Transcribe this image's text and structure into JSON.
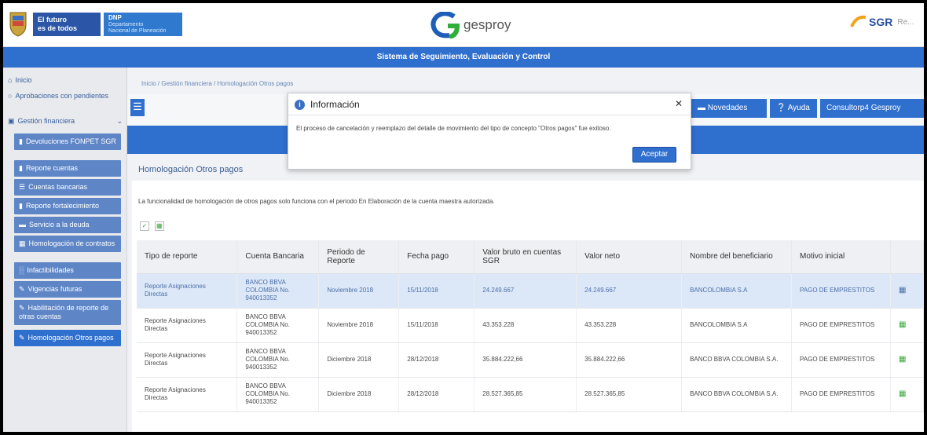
{
  "header": {
    "gov_logo_line1": "El futuro",
    "gov_logo_line2": "es de todos",
    "dnp_logo_title": "DNP",
    "dnp_logo_line1": "Departamento",
    "dnp_logo_line2": "Nacional de Planeación",
    "app_logo": "gesproy",
    "sgr_logo": "SGR",
    "sgr_sub": "Re..."
  },
  "system_bar": {
    "title": "Sistema de Seguimiento, Evaluación y Control"
  },
  "sidebar": {
    "items": [
      {
        "label": "Inicio"
      },
      {
        "label": "Aprobaciones con pendientes"
      },
      {
        "label": "Gestión financiera"
      }
    ],
    "subitems": [
      {
        "label": "Devoluciones FONPET SGR"
      },
      {
        "label": "Reporte cuentas"
      },
      {
        "label": "Cuentas bancarias"
      },
      {
        "label": "Reporte fortalecimiento"
      },
      {
        "label": "Servicio a la deuda"
      },
      {
        "label": "Homologación de contratos"
      },
      {
        "label": "Infactibilidades"
      },
      {
        "label": "Vigencias futuras"
      },
      {
        "label": "Habilitación de reporte de otras cuentas"
      },
      {
        "label": "Homologación Otros pagos"
      }
    ]
  },
  "breadcrumb": "Inicio / Gestión financiera / Homologación Otros pagos",
  "toolbar": {
    "novedades": "Novedades",
    "ayuda": "Ayuda",
    "consultor": "Consultorp4 Gesproy"
  },
  "page": {
    "title": "Homologación Otros pagos",
    "note": "La funcionalidad de homologación de otros pagos solo funciona con el periodo En Elaboración de la cuenta maestra autorizada."
  },
  "table": {
    "headers": [
      "Tipo de reporte",
      "Cuenta Bancaria",
      "Periodo de Reporte",
      "Fecha pago",
      "Valor bruto en cuentas SGR",
      "Valor neto",
      "Nombre del beneficiario",
      "Motivo inicial"
    ],
    "rows": [
      [
        "Reporte Asignaciones Directas",
        "BANCO BBVA COLOMBIA No. 940013352",
        "Noviembre 2018",
        "15/11/2018",
        "24.249.667",
        "24.249.667",
        "BANCOLOMBIA S.A",
        "PAGO DE EMPRESTITOS"
      ],
      [
        "Reporte Asignaciones Directas",
        "BANCO BBVA COLOMBIA No. 940013352",
        "Noviembre 2018",
        "15/11/2018",
        "43.353.228",
        "43.353.228",
        "BANCOLOMBIA S.A",
        "PAGO DE EMPRESTITOS"
      ],
      [
        "Reporte Asignaciones Directas",
        "BANCO BBVA COLOMBIA No. 940013352",
        "Diciembre 2018",
        "28/12/2018",
        "35.884.222,66",
        "35.884.222,66",
        "BANCO BBVA COLOMBIA S.A.",
        "PAGO DE EMPRESTITOS"
      ],
      [
        "Reporte Asignaciones Directas",
        "BANCO BBVA COLOMBIA No. 940013352",
        "Diciembre 2018",
        "28/12/2018",
        "28.527.365,85",
        "28.527.365,85",
        "BANCO BBVA COLOMBIA S.A.",
        "PAGO DE EMPRESTITOS"
      ]
    ]
  },
  "modal": {
    "title": "Información",
    "body": "El proceso de cancelación y reemplazo del detalle de movimiento del tipo de concepto \"Otros pagos\" fue exitoso.",
    "accept": "Aceptar"
  },
  "colors": {
    "primary": "#2f6fce",
    "sidebar_bg": "#e8eaed",
    "selected_row": "#dce8f8"
  }
}
